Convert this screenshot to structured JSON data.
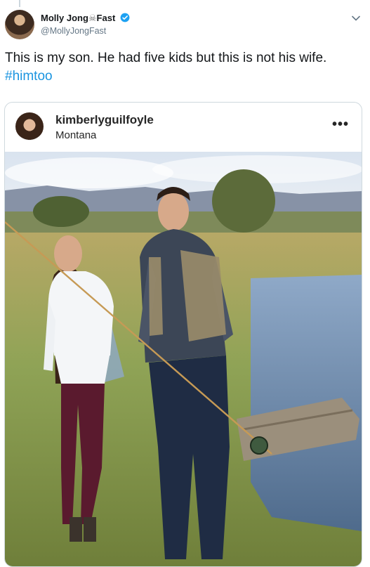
{
  "tweet": {
    "author_name": "Molly Jong",
    "author_name_suffix": "Fast",
    "author_skull_glyph": "☠",
    "handle": "@MollyJongFast",
    "text": "This is my son. He had five kids but this is not his wife.",
    "hashtag": "#himtoo",
    "verified_color": "#1da1f2",
    "link_color": "#1b95e0"
  },
  "embedded_post": {
    "username": "kimberlyguilfoyle",
    "location": "Montana",
    "more_glyph": "•••"
  },
  "icons": [
    "verified-badge-icon",
    "chevron-down-icon",
    "more-options-icon"
  ]
}
